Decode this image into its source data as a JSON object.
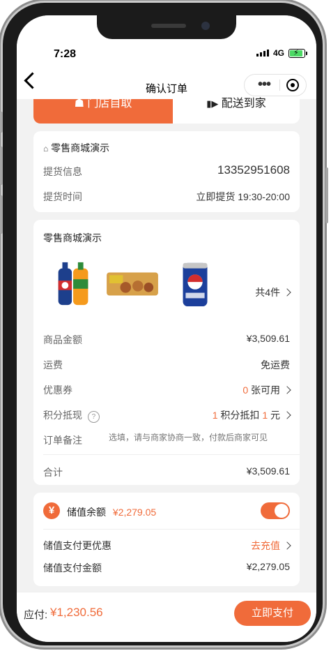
{
  "status_bar": {
    "time": "7:28",
    "network": "4G"
  },
  "nav": {
    "title": "确认订单",
    "more_icon": "more-dots-icon",
    "close_icon": "target-circle-icon"
  },
  "tabs": {
    "pickup": "门店自取",
    "delivery": "配送到家",
    "pickup_icon": "store-icon",
    "delivery_icon": "truck-icon"
  },
  "store_card": {
    "store_name": "零售商城演示",
    "pickup_info_label": "提货信息",
    "pickup_info_value": "13352951608",
    "pickup_time_label": "提货时间",
    "pickup_time_value": "立即提货 19:30-20:00"
  },
  "order_card": {
    "store_name": "零售商城演示",
    "item_count": "共4件",
    "products": [
      "soda-bottles",
      "snack-pack",
      "soda-can"
    ],
    "goods_amount_label": "商品金额",
    "goods_amount_value": "¥3,509.61",
    "shipping_label": "运费",
    "shipping_value": "免运费",
    "coupon_label": "优惠券",
    "coupon_count": "0",
    "coupon_suffix": "张可用",
    "points_label": "积分抵现",
    "points_count": "1",
    "points_middle": "积分抵扣",
    "points_amount": "1",
    "points_unit": "元",
    "remark_label": "订单备注",
    "remark_placeholder": "选填，请与商家协商一致，付款后商家可见",
    "total_label": "合计",
    "total_value": "¥3,509.61"
  },
  "balance_card": {
    "label": "储值余额",
    "amount": "¥2,279.05",
    "toggle_on": true,
    "promo_label": "储值支付更优惠",
    "recharge_link": "去充值",
    "pay_amount_label": "储值支付金额",
    "pay_amount_value": "¥2,279.05"
  },
  "bottom_bar": {
    "due_label": "应付:",
    "due_value": "¥1,230.56",
    "pay_button": "立即支付"
  },
  "colors": {
    "accent": "#f06b3a",
    "background": "#f2f2f2"
  }
}
